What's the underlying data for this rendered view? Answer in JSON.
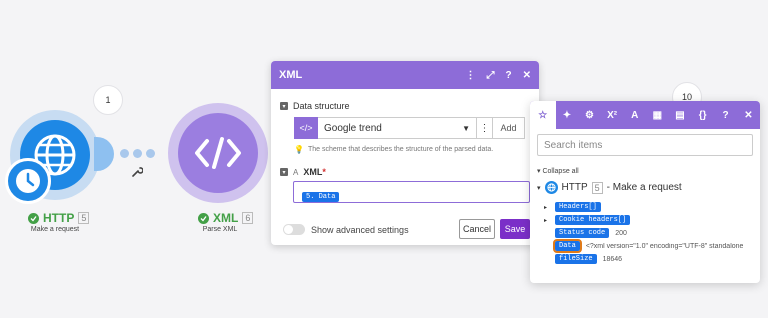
{
  "canvas": {
    "http_module": {
      "title": "HTTP",
      "index": "5",
      "subtitle": "Make a request",
      "bubble_count": "1",
      "icon": "globe-icon"
    },
    "xml_module": {
      "title": "XML",
      "index": "6",
      "subtitle": "Parse XML",
      "icon": "code-brackets-icon"
    },
    "right_bubble_count": "10"
  },
  "xml_dialog": {
    "title": "XML",
    "data_structure": {
      "label": "Data structure",
      "selected": "Google trend",
      "add_label": "Add",
      "hint": "The scheme that describes the structure of the parsed data."
    },
    "xml_field": {
      "type_letter": "A",
      "label": "XML",
      "required_mark": "*",
      "token": "5. Data"
    },
    "advanced_toggle_label": "Show advanced settings",
    "cancel_label": "Cancel",
    "save_label": "Save"
  },
  "mapping_panel": {
    "right_number": "10",
    "search_placeholder": "Search items",
    "collapse_label": "Collapse all",
    "module_name": "HTTP",
    "module_index": "5",
    "module_desc": "- Make a request",
    "items": [
      {
        "key": "Headers[]",
        "value": ""
      },
      {
        "key": "Cookie headers[]",
        "value": ""
      },
      {
        "key": "Status code",
        "value": "200"
      },
      {
        "key": "Data",
        "value": "<?xml version=\"1.0\" encoding=\"UTF-8\" standalone"
      },
      {
        "key": "fileSize",
        "value": "18646"
      }
    ]
  },
  "colors": {
    "purple": "#8d6cd8",
    "blue": "#1e88e5",
    "save": "#7b2fc8",
    "highlight": "#e07b1a"
  }
}
